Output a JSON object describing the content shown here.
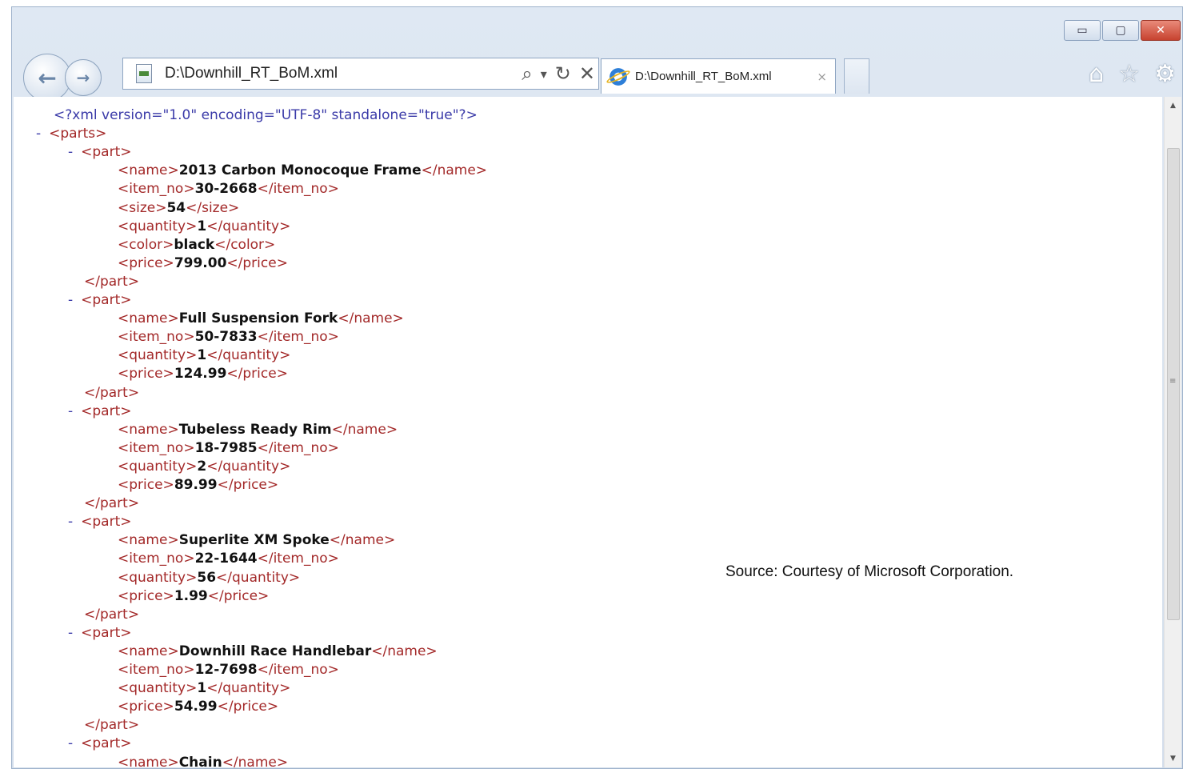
{
  "window": {
    "buttons": {
      "minimize": "▭",
      "maximize": "▢",
      "close": "✕"
    }
  },
  "toolbar": {
    "back_icon": "arrow-left-icon",
    "forward_icon": "arrow-right-icon",
    "address": "D:\\Downhill_RT_BoM.xml",
    "search_glyph": "⌕",
    "dropdown_glyph": "▾",
    "refresh_glyph": "↻",
    "stop_glyph": "✕",
    "right_icons": {
      "home": "⌂",
      "favorites": "☆",
      "settings": "⚙"
    }
  },
  "tab": {
    "label": "D:\\Downhill_RT_BoM.xml",
    "close_glyph": "×"
  },
  "xml": {
    "declaration": "<?xml version=\"1.0\" encoding=\"UTF-8\" standalone=\"true\"?>",
    "root_open": "<parts>",
    "collapse_glyph": "-",
    "part_open": "<part>",
    "part_close": "</part>",
    "parts": [
      {
        "fields": [
          {
            "open": "<name>",
            "value": "2013 Carbon Monocoque Frame",
            "close": "</name>"
          },
          {
            "open": "<item_no>",
            "value": "30-2668",
            "close": "</item_no>"
          },
          {
            "open": "<size>",
            "value": "54",
            "close": "</size>"
          },
          {
            "open": "<quantity>",
            "value": "1",
            "close": "</quantity>"
          },
          {
            "open": "<color>",
            "value": "black",
            "close": "</color>"
          },
          {
            "open": "<price>",
            "value": "799.00",
            "close": "</price>"
          }
        ]
      },
      {
        "fields": [
          {
            "open": "<name>",
            "value": "Full Suspension Fork",
            "close": "</name>"
          },
          {
            "open": "<item_no>",
            "value": "50-7833",
            "close": "</item_no>"
          },
          {
            "open": "<quantity>",
            "value": "1",
            "close": "</quantity>"
          },
          {
            "open": "<price>",
            "value": "124.99",
            "close": "</price>"
          }
        ]
      },
      {
        "fields": [
          {
            "open": "<name>",
            "value": "Tubeless Ready Rim",
            "close": "</name>"
          },
          {
            "open": "<item_no>",
            "value": "18-7985",
            "close": "</item_no>"
          },
          {
            "open": "<quantity>",
            "value": "2",
            "close": "</quantity>"
          },
          {
            "open": "<price>",
            "value": "89.99",
            "close": "</price>"
          }
        ]
      },
      {
        "fields": [
          {
            "open": "<name>",
            "value": "Superlite XM Spoke",
            "close": "</name>"
          },
          {
            "open": "<item_no>",
            "value": "22-1644",
            "close": "</item_no>"
          },
          {
            "open": "<quantity>",
            "value": "56",
            "close": "</quantity>"
          },
          {
            "open": "<price>",
            "value": "1.99",
            "close": "</price>"
          }
        ]
      },
      {
        "fields": [
          {
            "open": "<name>",
            "value": "Downhill Race Handlebar",
            "close": "</name>"
          },
          {
            "open": "<item_no>",
            "value": "12-7698",
            "close": "</item_no>"
          },
          {
            "open": "<quantity>",
            "value": "1",
            "close": "</quantity>"
          },
          {
            "open": "<price>",
            "value": "54.99",
            "close": "</price>"
          }
        ]
      },
      {
        "fields": [
          {
            "open": "<name>",
            "value": "Chain",
            "close": "</name>"
          }
        ]
      }
    ]
  },
  "scrollbar": {
    "up": "▲",
    "down": "▼",
    "grip": "≡"
  },
  "source_note": "Source: Courtesy of Microsoft Corporation."
}
